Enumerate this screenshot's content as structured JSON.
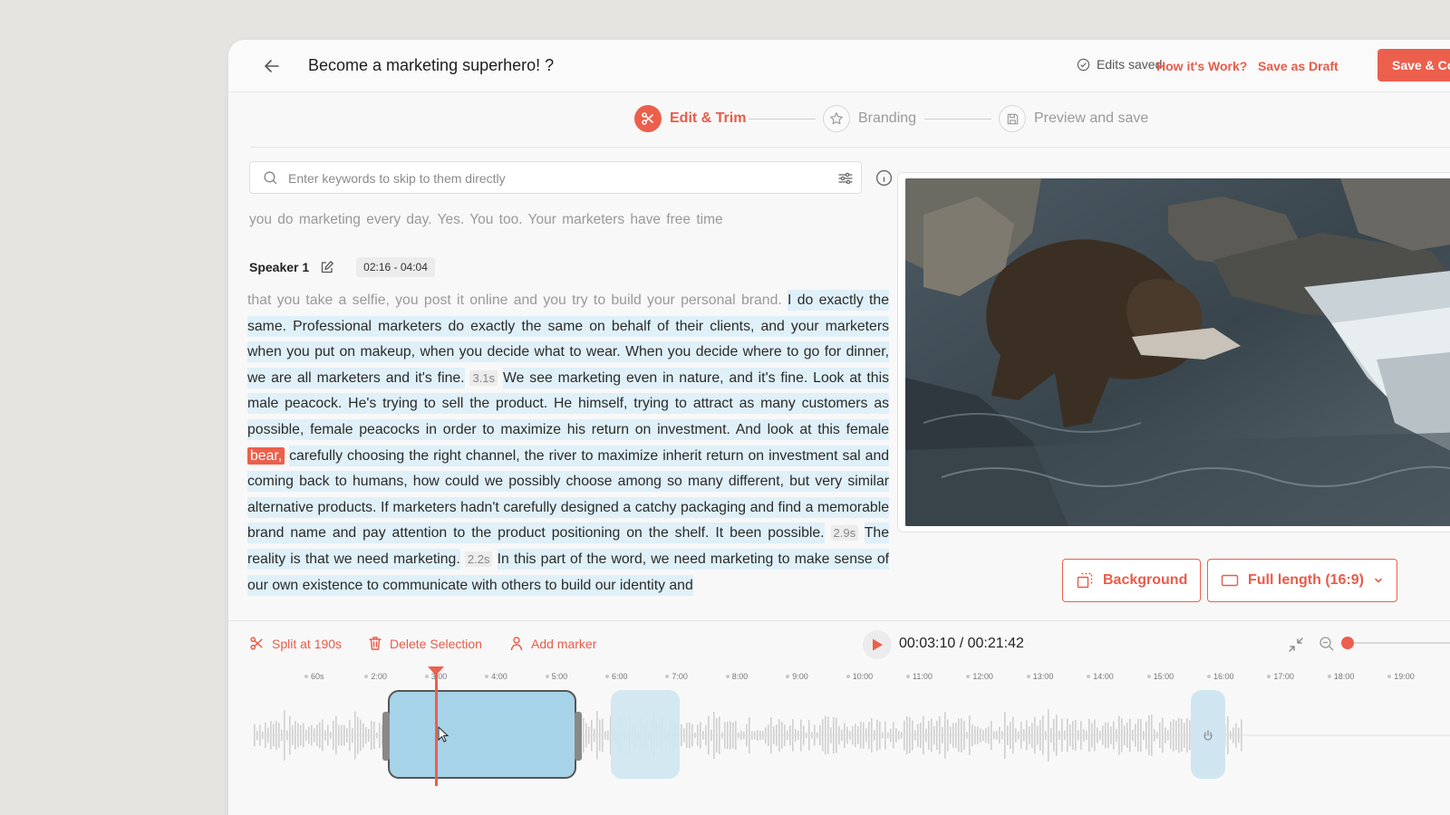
{
  "header": {
    "back_icon": "arrow-left-icon",
    "title": "Become a marketing superhero! ?",
    "status": "Edits saved",
    "how_link": "How it's Work?",
    "draft_link": "Save as Draft",
    "save_button": "Save & Co"
  },
  "steps": [
    {
      "label": "Edit & Trim",
      "icon": "scissors-icon",
      "active": true
    },
    {
      "label": "Branding",
      "icon": "star-icon",
      "active": false
    },
    {
      "label": "Preview and save",
      "icon": "save-icon",
      "active": false
    }
  ],
  "search": {
    "placeholder": "Enter keywords to skip to them directly"
  },
  "transcript": {
    "previous_line": "you do marketing every day. Yes. You too. Your marketers have free time",
    "speaker": "Speaker 1",
    "time_range": "02:16 - 04:04",
    "p0": "that you take a selfie, you post it online and you try to build your personal brand.",
    "p1": "I do exactly the same. Professional marketers do exactly the same on behalf of their clients, and your marketers when you put on makeup, when you decide what to wear. When you decide where to go for dinner, we are all marketers and it's fine.",
    "pause1": "3.1s",
    "p2": "We see marketing even in nature, and it's fine. Look at this male peacock. He's trying to sell the product. He himself, trying to attract as many customers as possible, female peacocks in order to maximize his return on investment. And look at this female",
    "hit": "bear,",
    "p3": "carefully choosing the right channel, the river to maximize inherit return on investment sal and coming back to humans, how could we possibly choose among so many different, but very similar alternative products. If marketers hadn't carefully designed a catchy packaging and find a memorable brand name and pay attention to the product positioning on the shelf. It been possible.",
    "pause2": "2.9s",
    "p4": "The reality is that we need marketing.",
    "pause3": "2.2s",
    "p5": "In this part of the word, we need marketing to make sense of our own existence to communicate with others to build our identity and"
  },
  "video": {
    "background_button": "Background",
    "aspect_button": "Full length (16:9)"
  },
  "toolbar": {
    "split": "Split at 190s",
    "delete": "Delete Selection",
    "marker": "Add marker",
    "timecode": "00:03:10 / 00:21:42"
  },
  "timeline": {
    "ticks": [
      "60s",
      "2:00",
      "3:00",
      "4:00",
      "5:00",
      "6:00",
      "7:00",
      "8:00",
      "9:00",
      "10:00",
      "11:00",
      "12:00",
      "13:00",
      "14:00",
      "15:00",
      "16:00",
      "17:00",
      "18:00",
      "19:00"
    ],
    "zoom_level": 0
  },
  "colors": {
    "accent": "#ec5f4c",
    "selection": "#a7d3e8",
    "highlight": "#dff0f8"
  }
}
